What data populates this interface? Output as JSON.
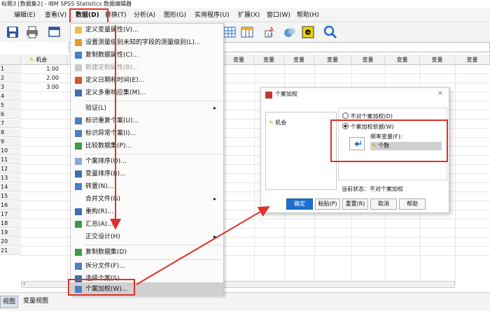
{
  "window": {
    "title": "标题3 [数据集2] - IBM SPSS Statistics 数据编辑器"
  },
  "menubar": [
    "编辑(E)",
    "查看(V)",
    "数据(D)",
    "转换(T)",
    "分析(A)",
    "图形(G)",
    "实用程序(U)",
    "扩展(X)",
    "窗口(W)",
    "帮助(H)"
  ],
  "grid": {
    "var1_name": "机会",
    "empty_var_label": "变量",
    "row_numbers": [
      "1",
      "2",
      "3",
      "4",
      "5",
      "6",
      "7",
      "8",
      "9",
      "10",
      "11",
      "12",
      "13",
      "14",
      "15",
      "16",
      "17",
      "18",
      "19",
      "20",
      "21"
    ],
    "values": [
      "1.00",
      "2.00",
      "3.00"
    ]
  },
  "tabs": {
    "data_view": "视图",
    "variable_view": "变量视图"
  },
  "data_menu": {
    "items": [
      "定义变量属性(V)...",
      "设置测量级别未知的字段的测量级别(L)...",
      "复制数据属性(C)...",
      "新建定制属性(B)...",
      "定义日期和时间(E)...",
      "定义多重响应集(M)...",
      "验证(L)",
      "标识重复个案(U)...",
      "标识异常个案(I)...",
      "比较数据集(P)...",
      "个案排序(O)...",
      "变量排序(B)...",
      "转置(N)...",
      "合并文件(G)",
      "重构(R)...",
      "汇总(A)...",
      "正交设计(H)",
      "复制数据集(D)",
      "拆分文件(F)...",
      "选择个案(S)...",
      "个案加权(W)..."
    ]
  },
  "weight_dialog": {
    "title": "个案加权",
    "variable": "机会",
    "option_no_weight": "不对个案加权(D)",
    "option_weight_by": "个案加权依据(W)",
    "freq_var_label": "频率变量(F):",
    "freq_var_value": "个数",
    "status": "当前状态：不对个案加权",
    "buttons": {
      "ok": "确定",
      "paste": "粘贴(P)",
      "reset": "重置(R)",
      "cancel": "取消",
      "help": "帮助"
    }
  },
  "colors": {
    "annotation_red": "#e0302a",
    "accent_blue": "#1f6fd1",
    "selection": "#d0d0d0"
  }
}
